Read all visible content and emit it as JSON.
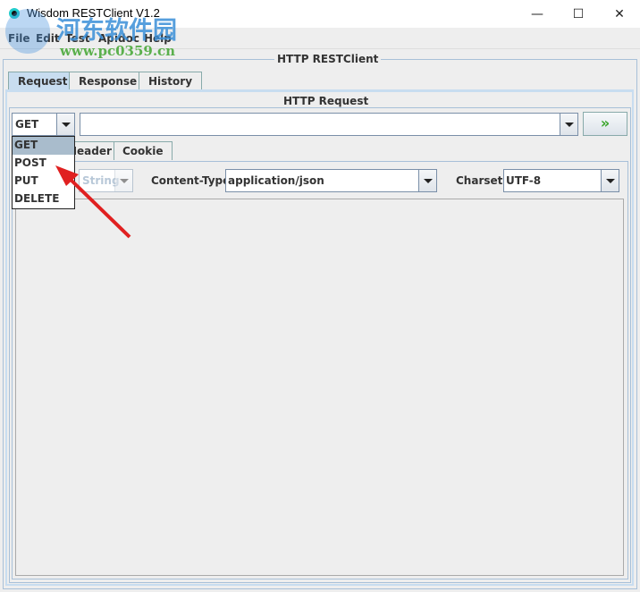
{
  "window": {
    "title": "Wisdom RESTClient V1.2",
    "minimize": "—",
    "maximize": "☐",
    "close": "✕"
  },
  "menu": [
    "File",
    "Edit",
    "Test",
    "Apidoc",
    "Help"
  ],
  "watermark": {
    "line1": "河东软件园",
    "line2": "www.pc0359.cn"
  },
  "main": {
    "group_title": "HTTP RESTClient",
    "tabs": [
      "Request",
      "Response",
      "History"
    ],
    "selected_tab": "Request"
  },
  "request": {
    "group_title": "HTTP Request",
    "method": "GET",
    "url": "",
    "send_icon": "double-chevron-right-icon",
    "method_options": [
      "GET",
      "POST",
      "PUT",
      "DELETE"
    ],
    "highlighted_option": "GET",
    "subtabs": [
      "Header",
      "Cookie"
    ],
    "subtab_partial": "eader",
    "body_type": "String",
    "content_type_label": "Content-Type:",
    "content_type": "application/json",
    "charset_label": "Charset:",
    "charset": "UTF-8",
    "body": ""
  },
  "colors": {
    "accent": "#c8ddf0",
    "send": "#3aa52a",
    "arrow": "#e02020"
  }
}
